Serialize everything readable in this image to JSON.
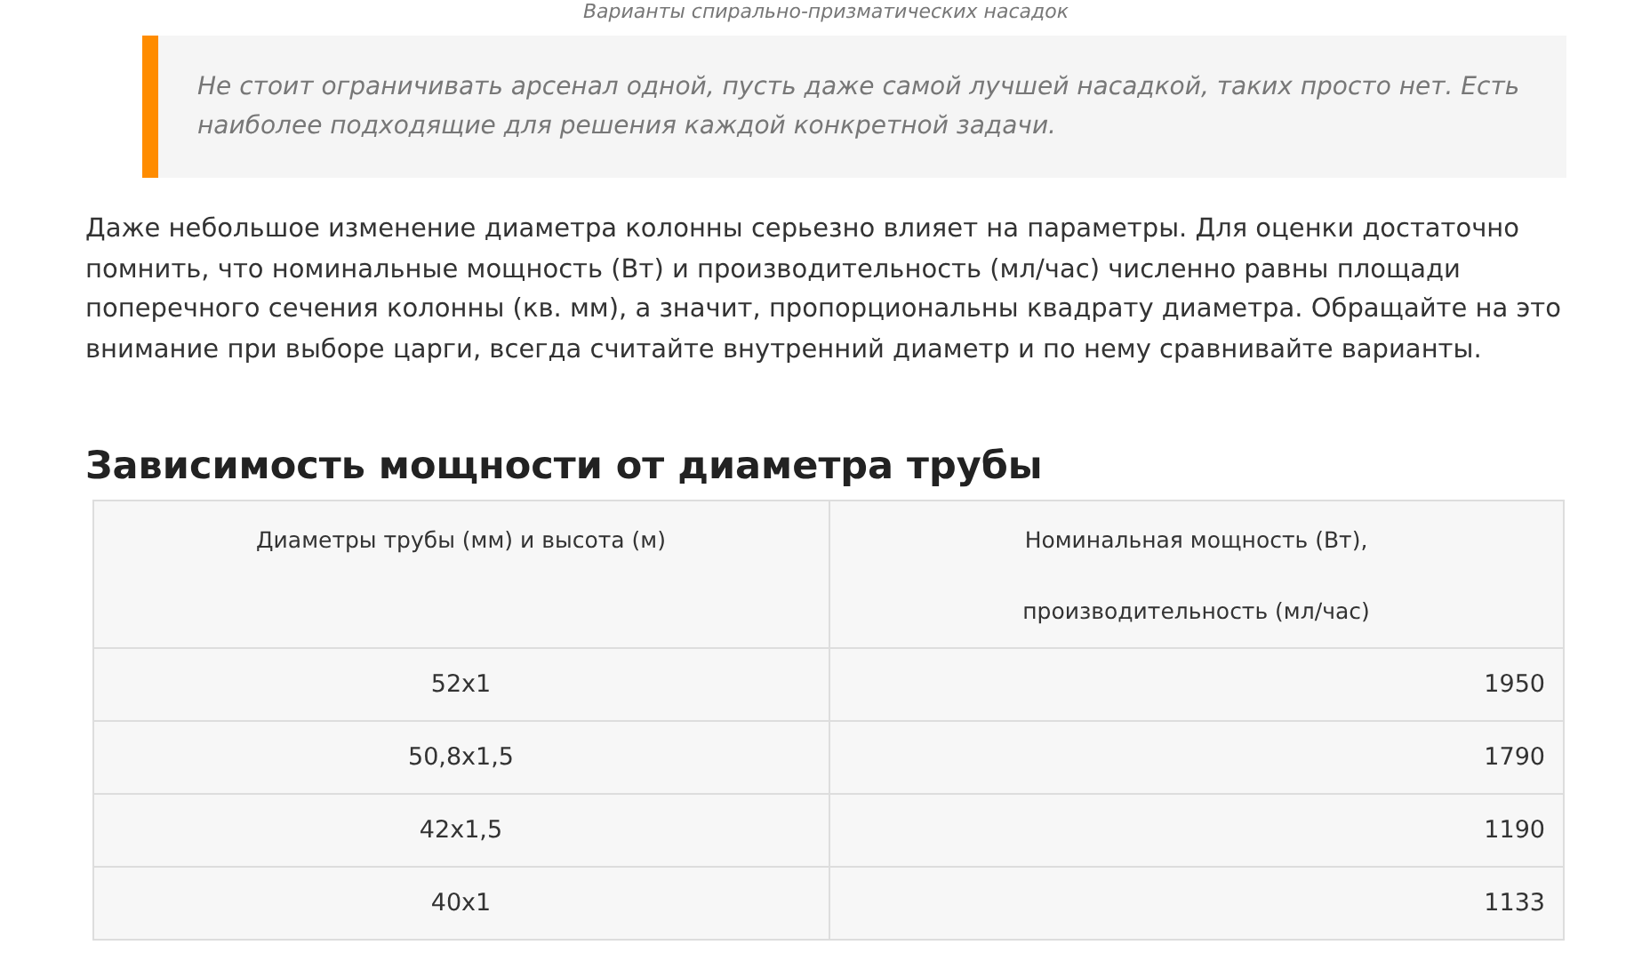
{
  "caption": "Варианты спирально-призматических насадок",
  "quote": "Не стоит ограничивать арсенал одной, пусть даже самой лучшей насадкой, таких просто нет. Есть наиболее подходящие для решения каждой конкретной задачи.",
  "paragraph": "Даже небольшое изменение диаметра колонны серьезно влияет на параметры. Для оценки достаточно помнить, что номинальные мощность (Вт) и производительность (мл/час) численно равны площади поперечного сечения колонны (кв. мм), а значит, пропорциональны квадрату диаметра. Обращайте на это внимание при выборе царги, всегда считайте внутренний диаметр и по нему сравнивайте варианты.",
  "heading": "Зависимость мощности от диаметра трубы",
  "table": {
    "columns": [
      "Диаметры трубы (мм) и высота (м)",
      "Номинальная мощность (Вт),\nпроизводительность (мл/час)"
    ],
    "rows": [
      [
        "52x1",
        "1950"
      ],
      [
        "50,8x1,5",
        "1790"
      ],
      [
        "42x1,5",
        "1190"
      ],
      [
        "40x1",
        "1133"
      ]
    ]
  }
}
